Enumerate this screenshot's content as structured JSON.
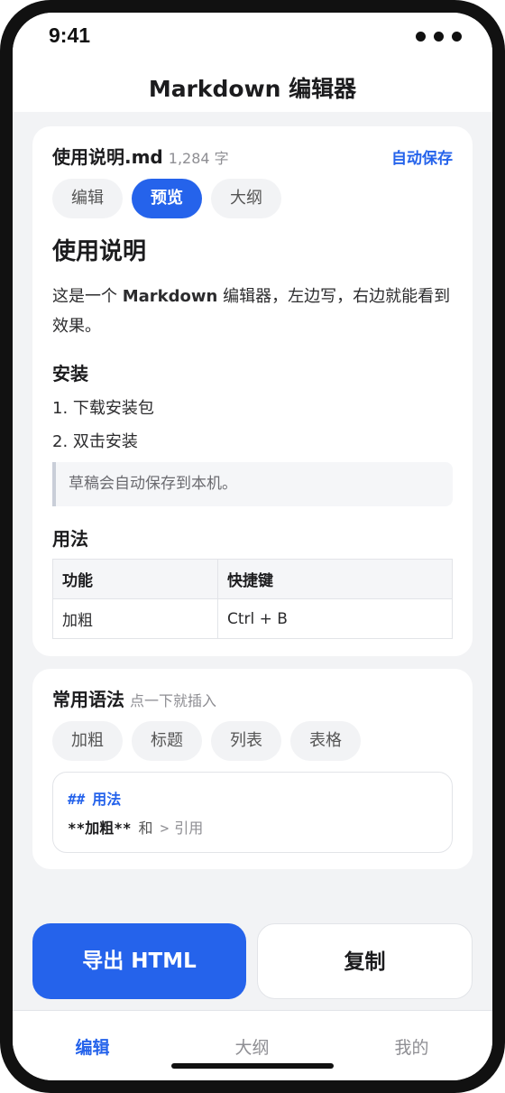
{
  "status": {
    "time": "9:41"
  },
  "header": {
    "title": "Markdown 编辑器"
  },
  "file": {
    "name": "使用说明.md",
    "count": "1,284 字",
    "autosave": "自动保存"
  },
  "modes": [
    {
      "label": "编辑",
      "active": false
    },
    {
      "label": "预览",
      "active": true
    },
    {
      "label": "大纲",
      "active": false
    }
  ],
  "preview": {
    "h1": "使用说明",
    "intro_before": "这是一个",
    "intro_bold": "Markdown",
    "intro_after": "编辑器，左边写，右边就能看到效果。",
    "install_heading": "安装",
    "steps": [
      "1. 下载安装包",
      "2. 双击安装"
    ],
    "quote": "草稿会自动保存到本机。",
    "usage_heading": "用法",
    "table": {
      "headers": [
        "功能",
        "快捷键"
      ],
      "rows": [
        [
          "加粗",
          "Ctrl + B"
        ]
      ]
    }
  },
  "syntax": {
    "title": "常用语法",
    "hint": "点一下就插入",
    "chips": [
      "加粗",
      "标题",
      "列表",
      "表格"
    ],
    "snippet": {
      "line1_marker": "##",
      "line1_text": "用法",
      "bold_token": "**加粗**",
      "and": "和",
      "gt": ">",
      "quote": "引用"
    }
  },
  "actions": {
    "export": "导出 HTML",
    "copy": "复制"
  },
  "tabs": [
    {
      "label": "编辑",
      "active": true
    },
    {
      "label": "大纲",
      "active": false
    },
    {
      "label": "我的",
      "active": false
    }
  ],
  "colors": {
    "accent": "#2563eb",
    "background": "#f2f3f5"
  }
}
